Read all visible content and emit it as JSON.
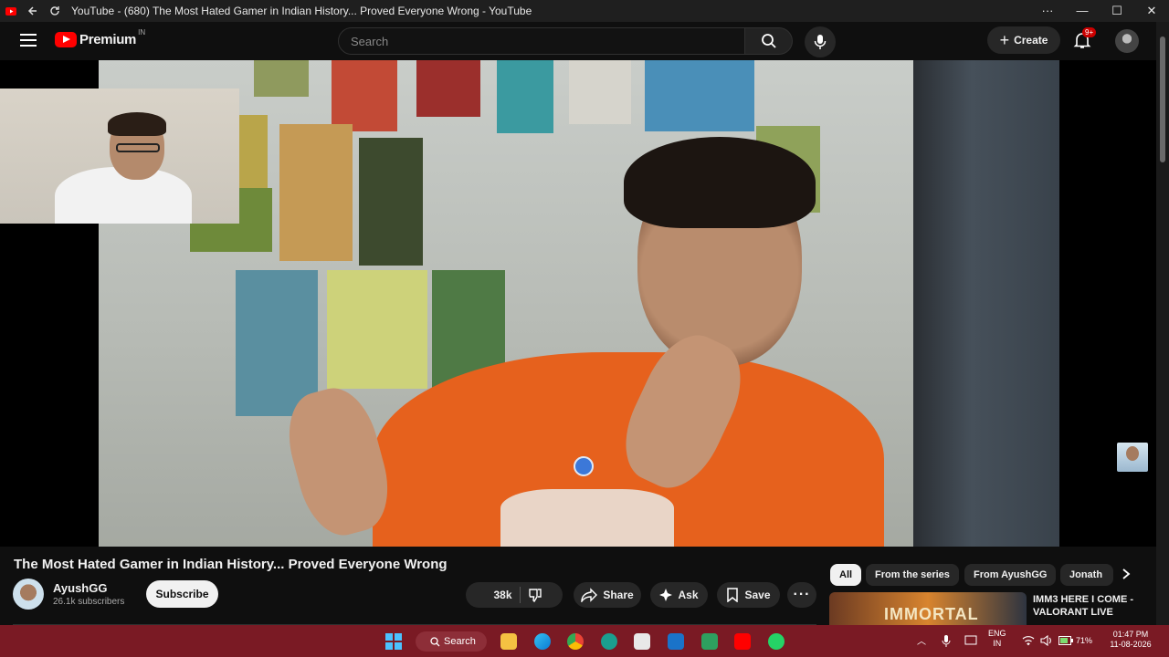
{
  "browser": {
    "tab_title": "YouTube - (680) The Most Hated Gamer in Indian History... Proved Everyone Wrong - YouTube",
    "window_controls": {
      "more": "···",
      "minimize": "—",
      "maximize": "☐",
      "close": "✕"
    }
  },
  "header": {
    "brand": "Premium",
    "region": "IN",
    "search_placeholder": "Search",
    "create_label": "Create",
    "notification_badge": "9+"
  },
  "video": {
    "title": "The Most Hated Gamer in Indian History... Proved Everyone Wrong",
    "channel_name": "AyushGG",
    "subscribers": "26.1k subscribers",
    "subscribe_label": "Subscribe",
    "likes": "38k",
    "share_label": "Share",
    "ask_label": "Ask",
    "save_label": "Save",
    "more_label": "···"
  },
  "sidebar": {
    "chips": [
      {
        "label": "All",
        "active": true
      },
      {
        "label": "From the series",
        "active": false
      },
      {
        "label": "From AyushGG",
        "active": false
      },
      {
        "label": "Jonath",
        "active": false
      }
    ],
    "recommendation": {
      "title": "IMM3 HERE I COME - VALORANT LIVE",
      "thumb_text": "IMMORTAL"
    }
  },
  "taskbar": {
    "search_label": "Search",
    "language": "ENG",
    "language_region": "IN",
    "battery": "71%",
    "time": "01:47 PM",
    "date": "11-08-2026"
  },
  "colors": {
    "youtube_red": "#ff0000",
    "background": "#0f0f0f",
    "taskbar": "#7a1a24",
    "shirt_orange": "#e6611d"
  }
}
